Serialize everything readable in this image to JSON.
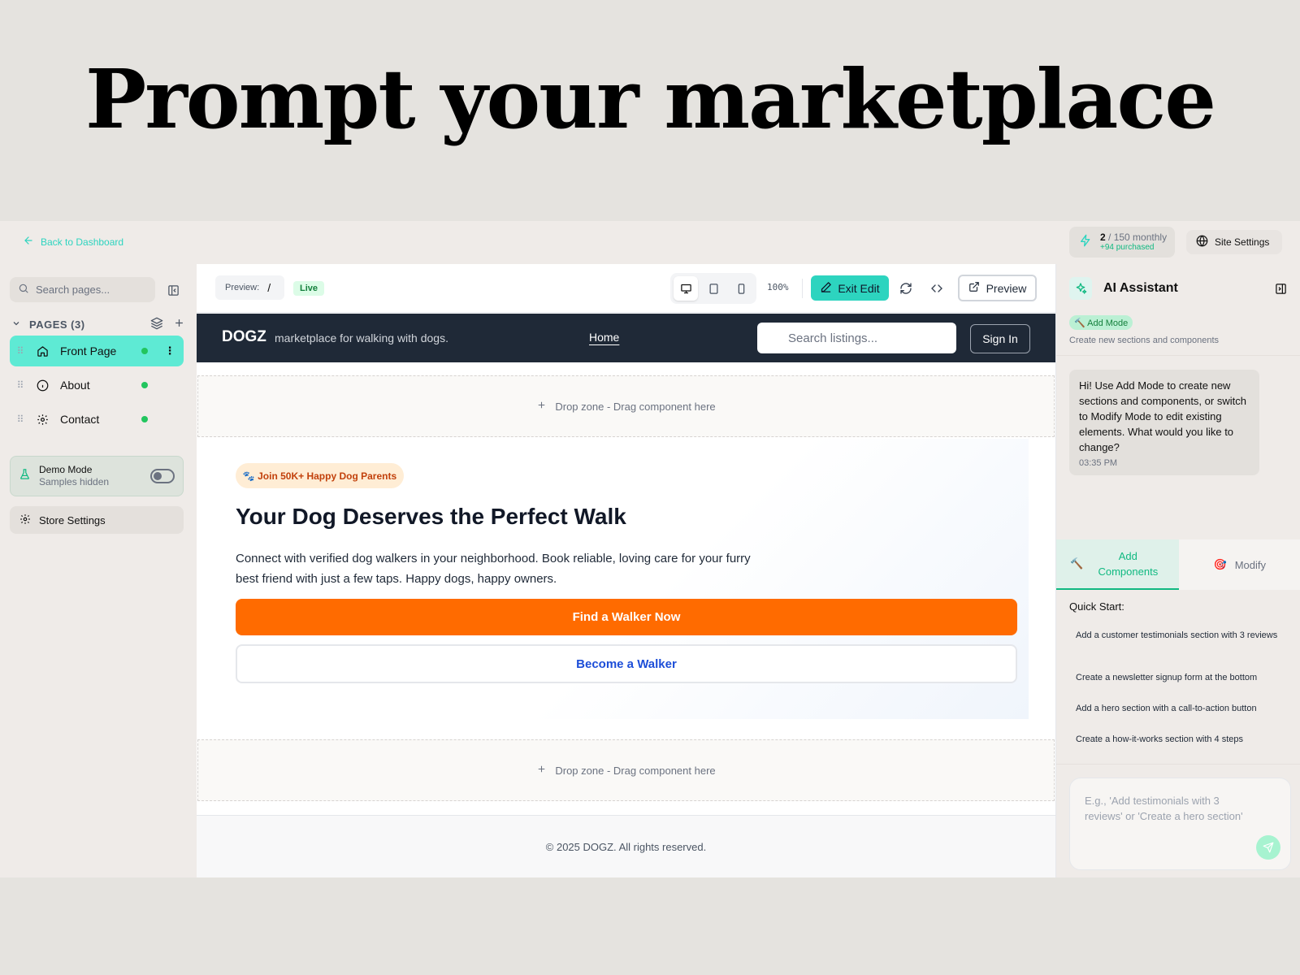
{
  "headline": "Prompt your marketplace",
  "topbar": {
    "back_label": "Back to Dashboard",
    "credits_used": "2",
    "credits_total": "/ 150 monthly",
    "credits_purchased": "+94 purchased",
    "site_settings": "Site Settings"
  },
  "sidebar": {
    "search_placeholder": "Search pages...",
    "pages_heading": "PAGES (3)",
    "pages": [
      {
        "label": "Front Page",
        "icon": "home-icon",
        "active": true
      },
      {
        "label": "About",
        "icon": "info-icon",
        "active": false
      },
      {
        "label": "Contact",
        "icon": "gear-icon",
        "active": false
      }
    ],
    "demo_title": "Demo Mode",
    "demo_subtitle": "Samples hidden",
    "store_settings": "Store Settings"
  },
  "editor": {
    "preview_label": "Preview:",
    "preview_path": "/",
    "live_badge": "Live",
    "zoom": "100%",
    "exit_edit": "Exit Edit",
    "preview_button": "Preview",
    "active_device": "desktop"
  },
  "site": {
    "brand": "DOGZ",
    "tagline": "marketplace for walking with dogs.",
    "nav_home": "Home",
    "search_placeholder": "Search listings...",
    "sign_in": "Sign In",
    "dropzone_label": "Drop zone - Drag component here",
    "hero": {
      "badge": "🐾 Join 50K+ Happy Dog Parents",
      "title": "Your Dog Deserves the Perfect Walk",
      "description": "Connect with verified dog walkers in your neighborhood. Book reliable, loving care for your furry best friend with just a few taps. Happy dogs, happy owners.",
      "primary_cta": "Find a Walker Now",
      "secondary_cta": "Become a Walker"
    },
    "footer": "© 2025 DOGZ. All rights reserved."
  },
  "assistant": {
    "title": "AI Assistant",
    "mode_badge": "🔨 Add Mode",
    "mode_description": "Create new sections and components",
    "message": "Hi! Use Add Mode to create new sections and components, or switch to Modify Mode to edit existing elements. What would you like to change?",
    "message_time": "03:35 PM",
    "tab_add": "Add Components",
    "tab_modify": "Modify",
    "quick_start_title": "Quick Start:",
    "quick_start": [
      "Add a customer testimonials section with 3 reviews",
      "Create a newsletter signup form at the bottom",
      "Add a hero section with a call-to-action button",
      "Create a how-it-works section with 4 steps"
    ],
    "input_placeholder": "E.g., 'Add testimonials with 3 reviews' or 'Create a hero section'"
  },
  "colors": {
    "accent_teal": "#2dd4bf",
    "cta_orange": "#ff6b00",
    "nav_dark": "#1f2937",
    "status_green": "#22c55e"
  }
}
